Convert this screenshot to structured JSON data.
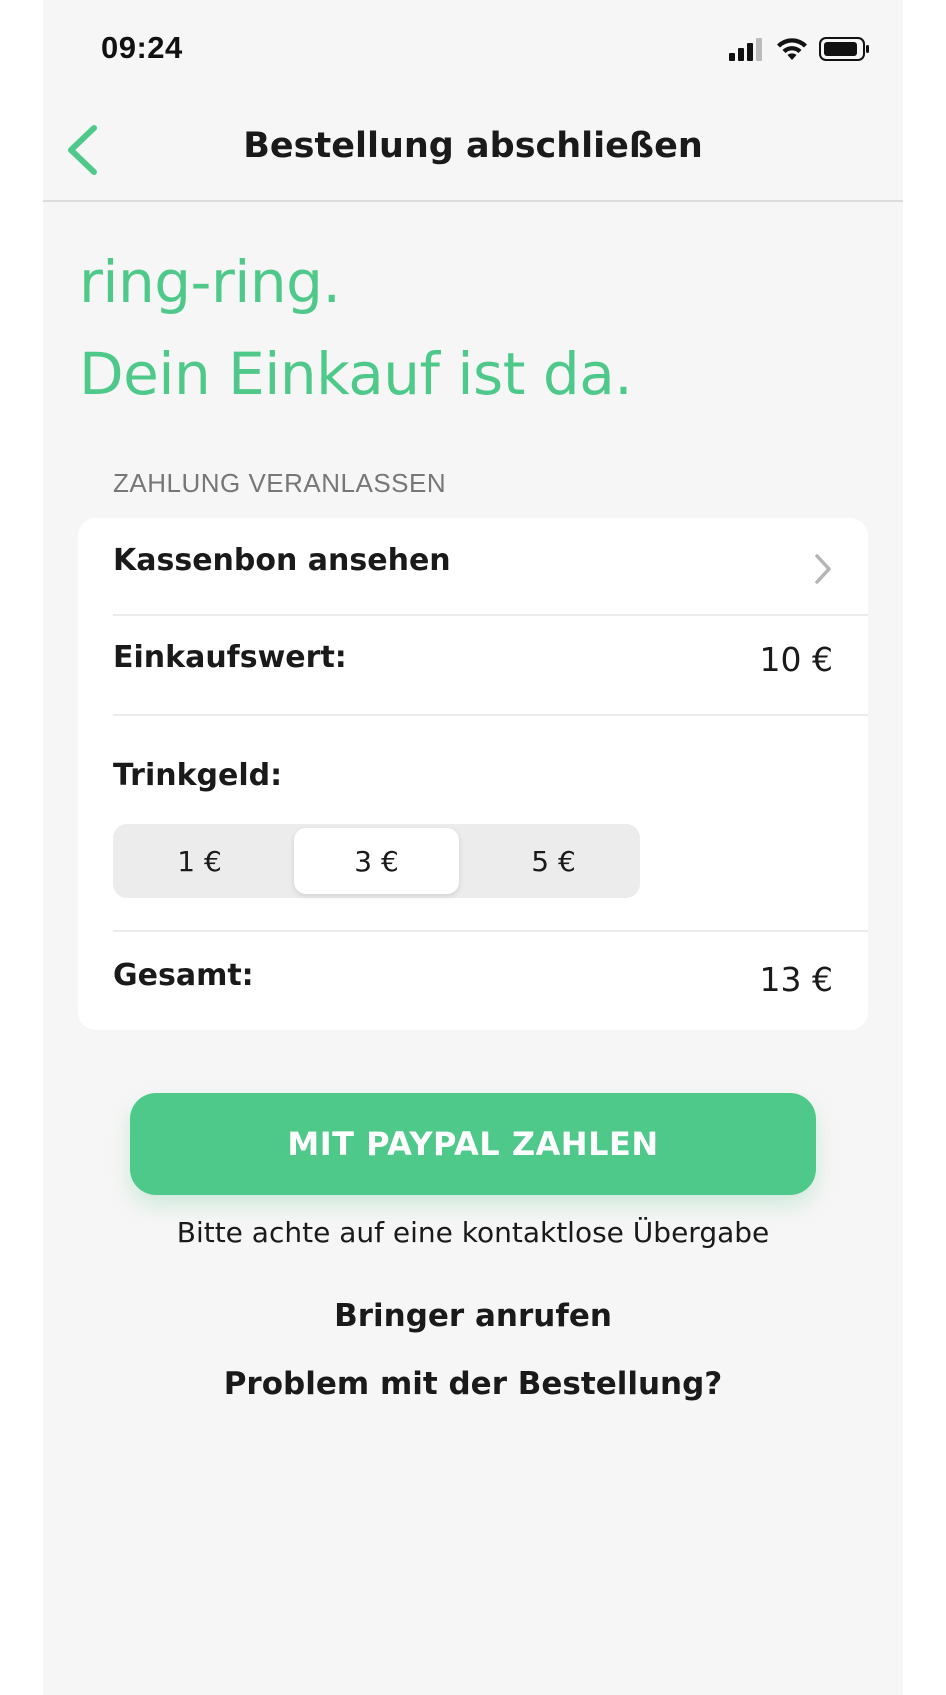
{
  "status_bar": {
    "time": "09:24",
    "icons": [
      "cellular-signal-icon",
      "wifi-icon",
      "battery-icon"
    ]
  },
  "nav": {
    "title": "Bestellung abschließen",
    "back_icon": "chevron-left-icon"
  },
  "headline": {
    "line1": "ring-ring.",
    "line2": "Dein Einkauf ist da."
  },
  "payment": {
    "section_title": "ZAHLUNG VERANLASSEN",
    "receipt_label": "Kassenbon ansehen",
    "receipt_icon": "chevron-right-icon",
    "purchase_label": "Einkaufswert:",
    "purchase_value": "10 €",
    "tip_label": "Trinkgeld:",
    "tip_options": [
      "1 €",
      "3 €",
      "5 €"
    ],
    "tip_selected": "3 €",
    "total_label": "Gesamt:",
    "total_value": "13 €"
  },
  "actions": {
    "pay_label": "MIT PAYPAL ZAHLEN",
    "hint": "Bitte achte auf eine kontaktlose Übergabe",
    "call_label": "Bringer anrufen",
    "problem_label": "Problem mit der Bestellung?"
  },
  "colors": {
    "accent": "#4fc98a",
    "background": "#f7f6f6",
    "card": "#ffffff",
    "text": "#1a1a1a",
    "muted": "#777777"
  }
}
